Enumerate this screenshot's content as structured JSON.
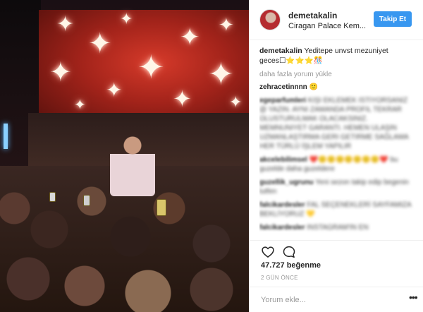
{
  "post": {
    "username": "demetakalin",
    "location": "Ciragan Palace Kem...",
    "follow_label": "Takip Et"
  },
  "caption": {
    "username": "demetakalin",
    "text": "Yeditepe unvst mezuniyet geces☐⭐⭐⭐🎊"
  },
  "load_more_label": "daha fazla yorum yükle",
  "comments": [
    {
      "user": "zehracetinnnn",
      "text": "🙂"
    },
    {
      "user": "egeparfumleri",
      "text": "KIŞI EKLEMEK ISTIYORSANIZ @ YAZIN. AYNI ZAMANDA PROFIL TEKRAR OLUSTURULMAK OLACAKSINIZ. MEMNUNIYET GARANTI. HEMEN ULAŞIN UZMANLAŞTIRMA GERI GETIRME SAĞLAMA HER TÜRLÜ İŞLEM YAPILIR"
    },
    {
      "user": "akcelebilimsel",
      "text": "❤️🙂🙂🙂🙂🙂🙂🙂❤️ bu guzelde daha guzeldere"
    },
    {
      "user": "guzellik_ugrunu",
      "text": "Yeni sezon takip edip begenin lutfen"
    },
    {
      "user": "falcikardesler",
      "text": "FAL SEÇENEKLERİ SAYFAMIZA BEKLİYORUZ 💛"
    },
    {
      "user": "falcikardesler",
      "text": "INSTAGRAM'IN EN"
    }
  ],
  "likes": "47.727 beğenme",
  "time_ago": "2 GÜN ÖNCE",
  "comment_placeholder": "Yorum ekle...",
  "more_icon": "•••",
  "colors": {
    "follow_button": "#3897f0",
    "muted_text": "#999999",
    "border": "#efefef"
  },
  "icons": {
    "like": "heart-icon",
    "comment": "comment-bubble-icon",
    "more": "more-options-icon"
  }
}
